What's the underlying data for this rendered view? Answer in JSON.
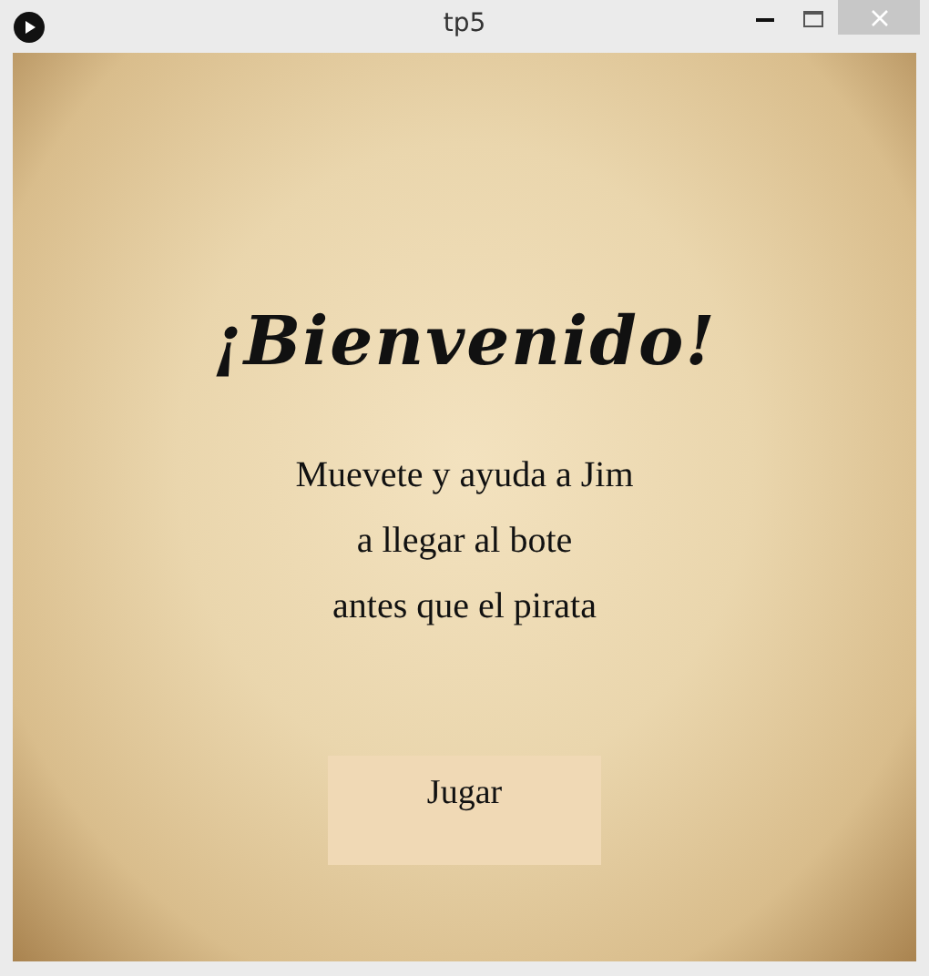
{
  "window": {
    "title": "tp5"
  },
  "heading": "¡Bienvenido!",
  "message_lines": [
    "Muevete y ayuda a Jim",
    "a llegar al bote",
    "antes que el pirata"
  ],
  "button": {
    "label": "Jugar"
  }
}
